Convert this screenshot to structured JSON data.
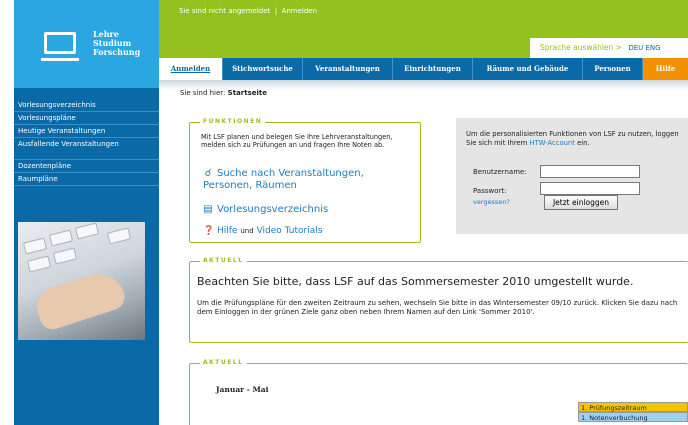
{
  "logo": {
    "lines": [
      "Lehre",
      "Studium",
      "Forschung"
    ]
  },
  "sidebar": {
    "items": [
      {
        "label": "Vorlesungsverzeichnis"
      },
      {
        "label": "Vorlesungspläne"
      },
      {
        "label": "Heutige Veranstaltungen"
      },
      {
        "label": "Ausfallende Veranstaltungen"
      },
      {
        "label": "Dozentenpläne"
      },
      {
        "label": "Raumpläne"
      }
    ]
  },
  "header": {
    "status_text": "Sie sind nicht angemeldet",
    "separator": "|",
    "login_link": "Anmelden",
    "language_label": "Sprache auswählen >",
    "language_codes": "DEU ENG"
  },
  "tabs": [
    {
      "label": "Anmelden",
      "active": true
    },
    {
      "label": "Stichwortsuche"
    },
    {
      "label": "Veranstaltungen"
    },
    {
      "label": "Einrichtungen"
    },
    {
      "label": "Räume und Gebäude"
    },
    {
      "label": "Personen"
    },
    {
      "label": "Hilfe"
    }
  ],
  "breadcrumb": {
    "prefix": "Sie sind hier:",
    "current": "Startseite"
  },
  "functions": {
    "title": "FUNKTIONEN",
    "description": "Mit LSF planen und belegen Sie Ihre Lehrveranstaltungen, melden sich zu Prüfungen an und fragen Ihre Noten ab.",
    "search_link": "Suche nach Veranstaltungen, Personen, Räumen",
    "vv_link": "Vorlesungsverzeichnis",
    "help_link": "Hilfe",
    "help_und": "und",
    "video_link": "Video Tutorials",
    "icons": [
      "search-icon",
      "document-icon",
      "help-icon"
    ]
  },
  "login": {
    "intro_part1": "Um die personalisierten Funktionen von LSF zu nutzen, loggen Sie sich mit Ihrem",
    "intro_link": "HTW-Account",
    "intro_part2": "ein.",
    "username_label": "Benutzername:",
    "username_value": "",
    "password_label": "Passwort:",
    "password_value": "",
    "forgot_link": "vergessen?",
    "submit_label": "Jetzt einloggen"
  },
  "news": [
    {
      "title": "AKTUELL",
      "headline": "Beachten Sie bitte, dass LSF auf das Sommersemester 2010 umgestellt wurde.",
      "body": "Um die Prüfungspläne für den zweiten Zeitraum zu sehen, wechseln Sie bitte in das Wintersemester 09/10 zurück. Klicken Sie dazu nach dem Einloggen in der grünen Ziele ganz oben neben Ihrem Namen auf den Link 'Sommer 2010'."
    },
    {
      "title": "AKTUELL",
      "month": "Januar - Mai",
      "legend": [
        "1. Prüfungszeitraum",
        "1. Notenverbuchung"
      ]
    }
  ],
  "colors": {
    "brand_blue": "#0a6aa8",
    "brand_green": "#95c11f",
    "help_orange": "#f39200"
  }
}
